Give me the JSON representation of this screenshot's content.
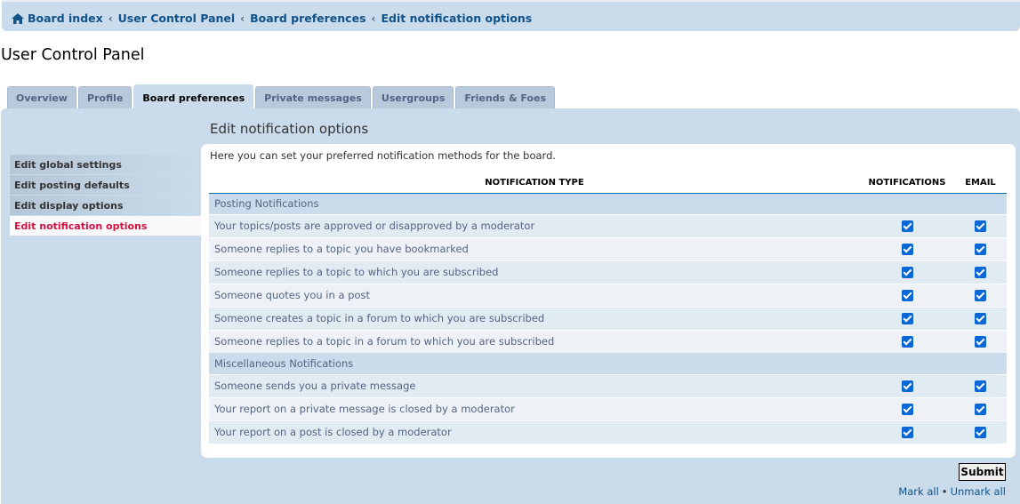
{
  "breadcrumb": {
    "items": [
      "Board index",
      "User Control Panel",
      "Board preferences",
      "Edit notification options"
    ],
    "separator": "‹"
  },
  "page_title": "User Control Panel",
  "tabs": [
    {
      "label": "Overview",
      "active": false
    },
    {
      "label": "Profile",
      "active": false
    },
    {
      "label": "Board preferences",
      "active": true
    },
    {
      "label": "Private messages",
      "active": false
    },
    {
      "label": "Usergroups",
      "active": false
    },
    {
      "label": "Friends & Foes",
      "active": false
    }
  ],
  "sidemenu": [
    {
      "label": "Edit global settings",
      "active": false
    },
    {
      "label": "Edit posting defaults",
      "active": false
    },
    {
      "label": "Edit display options",
      "active": false
    },
    {
      "label": "Edit notification options",
      "active": true
    }
  ],
  "content": {
    "heading": "Edit notification options",
    "intro": "Here you can set your preferred notification methods for the board.",
    "columns": {
      "type": "NOTIFICATION TYPE",
      "notifications": "NOTIFICATIONS",
      "email": "EMAIL"
    },
    "groups": [
      {
        "title": "Posting Notifications",
        "rows": [
          {
            "label": "Your topics/posts are approved or disapproved by a moderator",
            "notifications": true,
            "email": true
          },
          {
            "label": "Someone replies to a topic you have bookmarked",
            "notifications": true,
            "email": true
          },
          {
            "label": "Someone replies to a topic to which you are subscribed",
            "notifications": true,
            "email": true
          },
          {
            "label": "Someone quotes you in a post",
            "notifications": true,
            "email": true
          },
          {
            "label": "Someone creates a topic in a forum to which you are subscribed",
            "notifications": true,
            "email": true
          },
          {
            "label": "Someone replies to a topic in a forum to which you are subscribed",
            "notifications": true,
            "email": true
          }
        ]
      },
      {
        "title": "Miscellaneous Notifications",
        "rows": [
          {
            "label": "Someone sends you a private message",
            "notifications": true,
            "email": true
          },
          {
            "label": "Your report on a private message is closed by a moderator",
            "notifications": true,
            "email": true
          },
          {
            "label": "Your report on a post is closed by a moderator",
            "notifications": true,
            "email": true
          }
        ]
      }
    ]
  },
  "actions": {
    "submit": "Submit",
    "mark_all": "Mark all",
    "unmark_all": "Unmark all",
    "dot": "•"
  },
  "colors": {
    "accent": "#105289",
    "panel": "#cadceb",
    "active_menu": "#d31141",
    "checkbox": "#0a67d6"
  }
}
